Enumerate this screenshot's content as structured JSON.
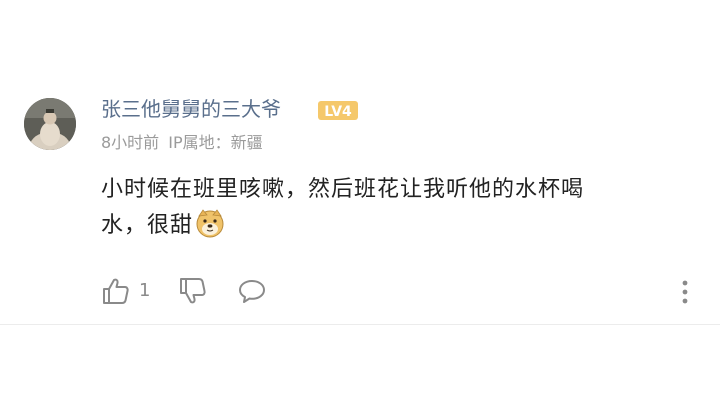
{
  "comment": {
    "username": "张三他舅舅的三大爷",
    "level_badge": "LV4",
    "time": "8小时前",
    "ip_label": "IP属地：新疆",
    "text_line1": "小时候在班里咳嗽，然后班花让我听他的水杯喝",
    "text_line2": "水，很甜",
    "emoji": "doge-emoji",
    "like_count": "1"
  },
  "icons": {
    "like": "thumbs-up-icon",
    "dislike": "thumbs-down-icon",
    "reply": "comment-bubble-icon",
    "more": "vertical-dots-icon"
  },
  "colors": {
    "username": "#5a6f8c",
    "badge": "#f5c86b",
    "meta": "#9b9b9b",
    "text": "#222222",
    "icon": "#8a8a8a"
  }
}
